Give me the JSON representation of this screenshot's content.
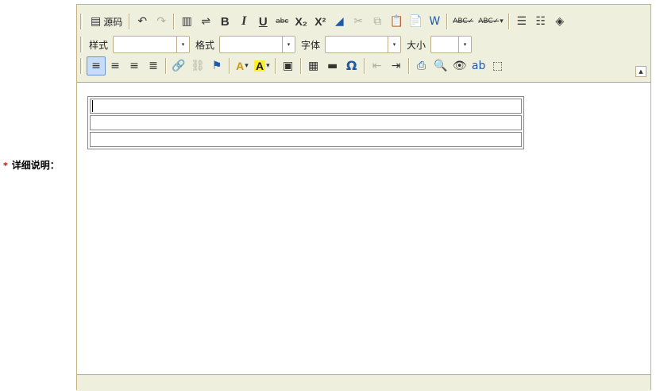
{
  "field": {
    "required_mark": "*",
    "label": "详细说明："
  },
  "toolbar": {
    "source_label": "源码",
    "style_label": "样式",
    "style_value": "",
    "format_label": "格式",
    "format_value": "",
    "font_label": "字体",
    "font_value": "",
    "size_label": "大小",
    "size_value": ""
  },
  "icons": {
    "source": "▤",
    "undo": "↶",
    "redo": "↷",
    "new_page": "▥",
    "page_break": "⇌",
    "bold": "B",
    "italic": "I",
    "underline": "U",
    "strike": "abc",
    "subscript": "X₂",
    "superscript": "X²",
    "remove_format": "◢",
    "cut": "✂",
    "copy": "⧉",
    "paste": "📋",
    "paste_text": "📄",
    "paste_word": "W",
    "spellcheck": "ABC✓",
    "scayt": "ABC✓",
    "ordered_list": "☰",
    "unordered_list": "☷",
    "maximize": "◈",
    "align_left": "≡",
    "align_center": "≡",
    "align_right": "≡",
    "justify": "≣",
    "link": "🔗",
    "unlink": "⛓",
    "anchor": "⚑",
    "font_color": "A",
    "bg_color": "A",
    "image": "▣",
    "table": "▦",
    "horizontal_rule": "▬",
    "special_char": "Ω",
    "outdent": "⇤",
    "indent": "⇥",
    "print": "⎙",
    "preview": "🔍",
    "find": "👁",
    "replace": "ab",
    "select_all": "⬚",
    "dropdown": "▾",
    "collapse": "▲"
  },
  "content": {
    "table_rows": 3
  }
}
